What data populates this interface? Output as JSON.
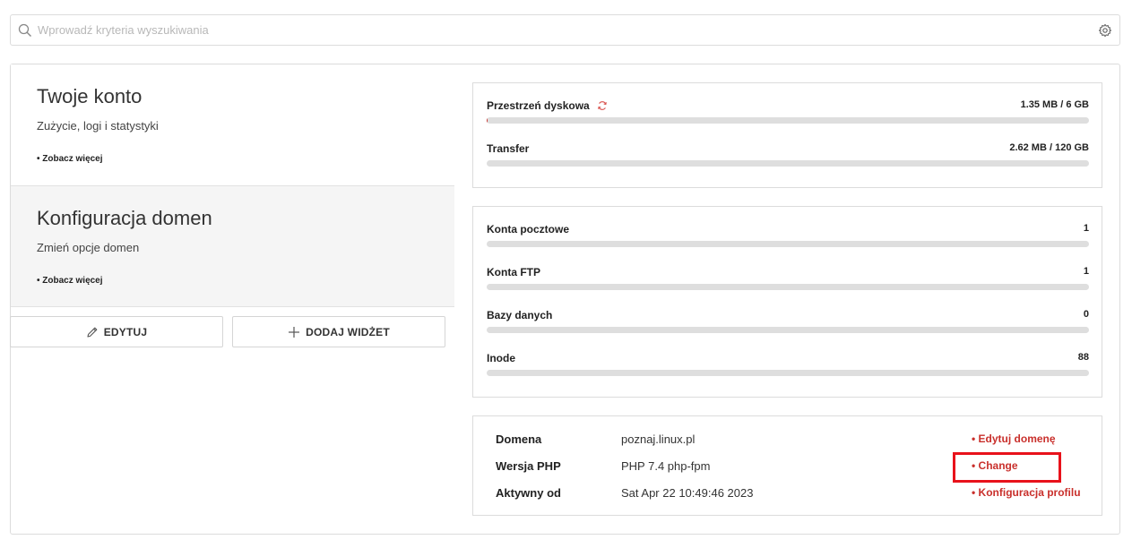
{
  "search": {
    "placeholder": "Wprowadź kryteria wyszukiwania"
  },
  "widgets": [
    {
      "title": "Twoje konto",
      "description": "Zużycie, logi i statystyki",
      "more": "• Zobacz więcej"
    },
    {
      "title": "Konfiguracja domen",
      "description": "Zmień opcje domen",
      "more": "• Zobacz więcej"
    }
  ],
  "buttons": {
    "edit": "EDYTUJ",
    "add": "DODAJ WIDŻET"
  },
  "usage": [
    {
      "label": "Przestrzeń dyskowa",
      "value": "1.35 MB / 6 GB",
      "fraction": 0.0002
    },
    {
      "label": "Transfer",
      "value": "2.62 MB / 120 GB",
      "fraction": 0.0
    }
  ],
  "counts": [
    {
      "label": "Konta pocztowe",
      "value": "1",
      "fraction": 0.0
    },
    {
      "label": "Konta FTP",
      "value": "1",
      "fraction": 0.0
    },
    {
      "label": "Bazy danych",
      "value": "0",
      "fraction": 0.0
    },
    {
      "label": "Inode",
      "value": "88",
      "fraction": 0.0
    }
  ],
  "details": [
    {
      "key": "Domena",
      "value": "poznaj.linux.pl",
      "action": "• Edytuj domenę"
    },
    {
      "key": "Wersja PHP",
      "value": "PHP 7.4 php-fpm",
      "action": "• Change"
    },
    {
      "key": "Aktywny od",
      "value": "Sat Apr 22 10:49:46 2023",
      "action": "• Konfiguracja profilu"
    }
  ],
  "colors": {
    "accent": "#c9302c",
    "highlight": "#e8121b",
    "bar_track": "#dedede"
  },
  "icons": {
    "search": "search-icon",
    "settings": "gear-icon",
    "edit": "pencil-icon",
    "add": "plus-icon",
    "refresh": "refresh-icon"
  }
}
